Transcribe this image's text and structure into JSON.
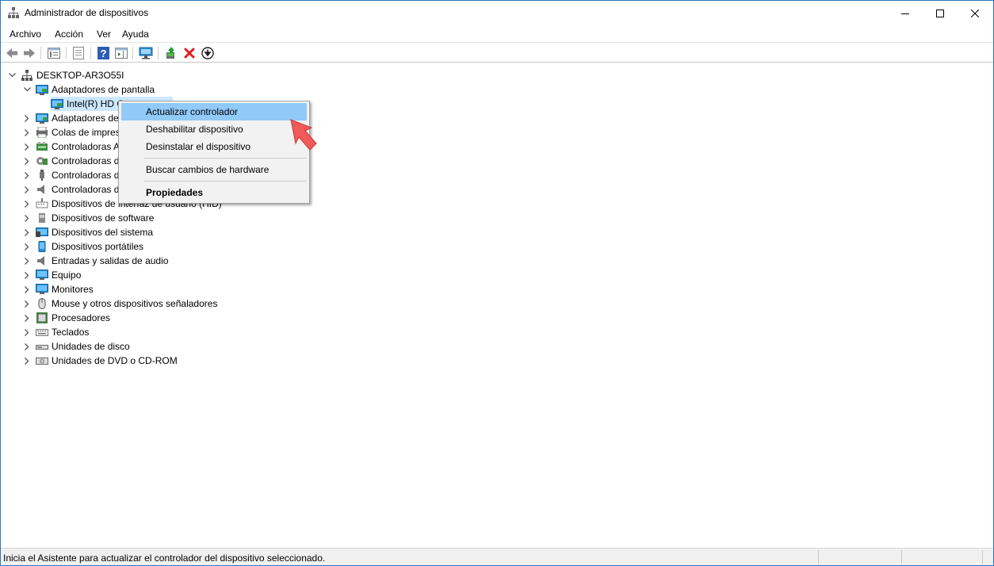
{
  "window": {
    "title": "Administrador de dispositivos"
  },
  "menu": [
    "Archivo",
    "Acción",
    "Ver",
    "Ayuda"
  ],
  "toolbar": {
    "buttons": [
      "back-icon",
      "forward-icon",
      "properties-list-icon",
      "console-tree-icon",
      "help-icon",
      "action-pane-icon",
      "scan-hardware-icon",
      "update-driver-icon",
      "uninstall-icon",
      "download-icon"
    ]
  },
  "tree": {
    "root": "DESKTOP-AR3O55I",
    "display_adapters": "Adaptadores de pantalla",
    "intel_device": "Intel(R) HD G",
    "categories": [
      "Adaptadores de",
      "Colas de impres",
      "Controladoras A",
      "Controladoras d",
      "Controladoras d",
      "Controladoras d",
      "Dispositivos de interfaz de usuario (HID)",
      "Dispositivos de software",
      "Dispositivos del sistema",
      "Dispositivos portátiles",
      "Entradas y salidas de audio",
      "Equipo",
      "Monitores",
      "Mouse y otros dispositivos señaladores",
      "Procesadores",
      "Teclados",
      "Unidades de disco",
      "Unidades de DVD o CD-ROM"
    ]
  },
  "context_menu": {
    "update_driver": "Actualizar controlador",
    "disable_device": "Deshabilitar dispositivo",
    "uninstall_device": "Desinstalar el dispositivo",
    "scan_changes": "Buscar cambios de hardware",
    "properties": "Propiedades"
  },
  "statusbar": {
    "text": "Inicia el Asistente para actualizar el controlador del dispositivo seleccionado."
  },
  "colors": {
    "selection": "#cce8ff",
    "menu_hover": "#91c9f7",
    "arrow": "#f05a5a"
  }
}
